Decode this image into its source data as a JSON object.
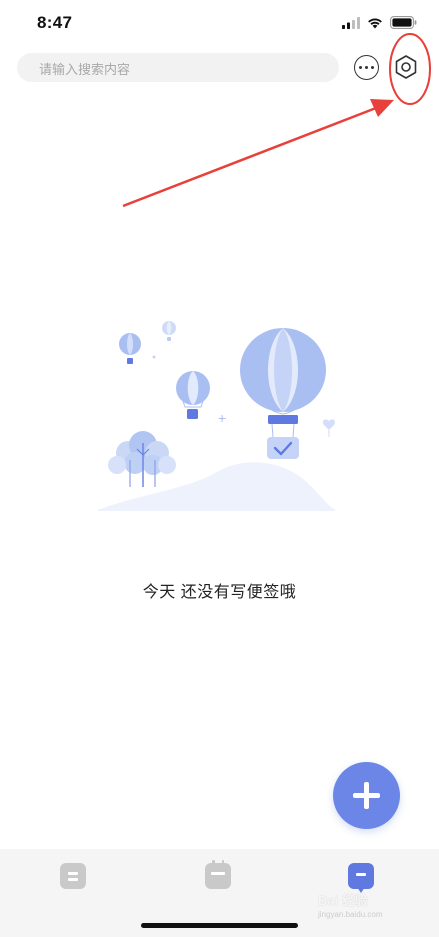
{
  "status_bar": {
    "time": "8:47",
    "icons": [
      "signal-icon",
      "wifi-icon",
      "battery-icon"
    ]
  },
  "search": {
    "placeholder": "请输入搜索内容"
  },
  "header_actions": {
    "more_icon": "more-horizontal-icon",
    "settings_icon": "hexagon-settings-icon"
  },
  "annotation": {
    "color": "#e8403a",
    "shapes": [
      "red-arrow",
      "red-ellipse"
    ]
  },
  "empty_state": {
    "illustration": "hot-air-balloons-illustration",
    "message": "今天 还没有写便签哦"
  },
  "fab": {
    "icon": "plus-icon",
    "color": "#6b86e6"
  },
  "tab_bar": {
    "tabs": [
      {
        "name": "notes",
        "icon": "notes-icon",
        "active": false
      },
      {
        "name": "calendar",
        "icon": "calendar-icon",
        "active": false
      },
      {
        "name": "memo",
        "icon": "memo-icon",
        "active": true
      }
    ],
    "active_color": "#5f79e0",
    "inactive_color": "#c9c9c9"
  },
  "watermark": {
    "text": "Bai 经验",
    "sub": "jingyan.baidu.com"
  }
}
